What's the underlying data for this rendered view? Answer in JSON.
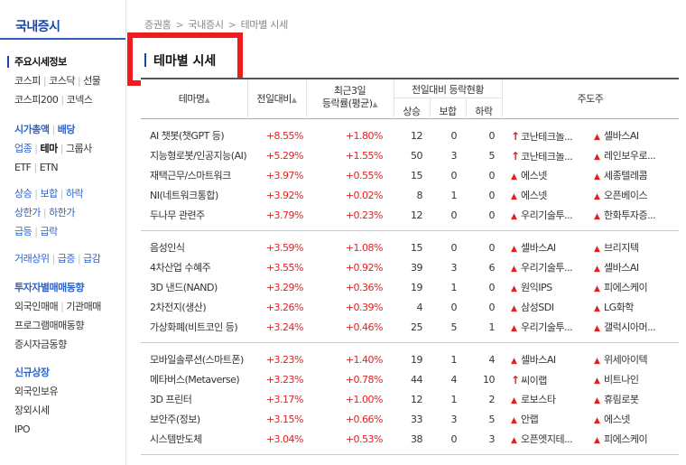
{
  "sidebar": {
    "title": "국내증시",
    "groups": [
      {
        "title": "주요시세정보",
        "rows": [
          [
            "코스피",
            "코스닥",
            "선물"
          ],
          [
            "코스피200",
            "코넥스"
          ]
        ]
      },
      {
        "title": "시가총액",
        "title2": "배당",
        "rows": [
          [
            "업종",
            "테마",
            "그룹사"
          ],
          [
            "ETF",
            "ETN"
          ]
        ]
      },
      {
        "rows": [
          [
            "상승",
            "보합",
            "하락"
          ],
          [
            "상한가",
            "하한가"
          ],
          [
            "급등",
            "급락"
          ]
        ]
      },
      {
        "rows": [
          [
            "거래상위",
            "급증",
            "급감"
          ]
        ]
      },
      {
        "title": "투자자별매매동향",
        "rows": [
          [
            "외국인매매",
            "기관매매"
          ],
          [
            "프로그램매매동향"
          ],
          [
            "증시자금동향"
          ]
        ]
      },
      {
        "title": "신규상장",
        "rows": [
          [
            "외국인보유"
          ],
          [
            "장외시세"
          ],
          [
            "IPO"
          ]
        ]
      }
    ]
  },
  "breadcrumb": [
    "증권홈",
    "국내증시",
    "테마별 시세"
  ],
  "page_title": "테마별 시세",
  "table": {
    "headers": {
      "name": "테마명",
      "change": "전일대비",
      "change3_line1": "최근3일",
      "change3_line2": "등락률(평균)",
      "status": "전일대비 등락현황",
      "up": "상승",
      "flat": "보합",
      "down": "하락",
      "leaders": "주도주"
    },
    "sort_icon": "▲",
    "groups": [
      [
        {
          "name": "AI 챗봇(챗GPT 등)",
          "chg": "+8.55%",
          "chg3": "+1.80%",
          "up": "12",
          "flat": "0",
          "down": "0",
          "l1": "코난테크놀...",
          "l1a": "limit",
          "l2": "셀바스AI",
          "l2a": "up"
        },
        {
          "name": "지능형로봇/인공지능(AI)",
          "chg": "+5.29%",
          "chg3": "+1.55%",
          "up": "50",
          "flat": "3",
          "down": "5",
          "l1": "코난테크놀...",
          "l1a": "limit",
          "l2": "레인보우로...",
          "l2a": "up"
        },
        {
          "name": "재택근무/스마트워크",
          "chg": "+3.97%",
          "chg3": "+0.55%",
          "up": "15",
          "flat": "0",
          "down": "0",
          "l1": "에스넷",
          "l1a": "up",
          "l2": "세종텔레콤",
          "l2a": "up"
        },
        {
          "name": "NI(네트워크통합)",
          "chg": "+3.92%",
          "chg3": "+0.02%",
          "up": "8",
          "flat": "1",
          "down": "0",
          "l1": "에스넷",
          "l1a": "up",
          "l2": "오픈베이스",
          "l2a": "up"
        },
        {
          "name": "두나무 관련주",
          "chg": "+3.79%",
          "chg3": "+0.23%",
          "up": "12",
          "flat": "0",
          "down": "0",
          "l1": "우리기술투...",
          "l1a": "up",
          "l2": "한화투자증...",
          "l2a": "up"
        }
      ],
      [
        {
          "name": "음성인식",
          "chg": "+3.59%",
          "chg3": "+1.08%",
          "up": "15",
          "flat": "0",
          "down": "0",
          "l1": "셀바스AI",
          "l1a": "up",
          "l2": "브리지텍",
          "l2a": "up"
        },
        {
          "name": "4차산업 수혜주",
          "chg": "+3.55%",
          "chg3": "+0.92%",
          "up": "39",
          "flat": "3",
          "down": "6",
          "l1": "우리기술투...",
          "l1a": "up",
          "l2": "셀바스AI",
          "l2a": "up"
        },
        {
          "name": "3D 낸드(NAND)",
          "chg": "+3.29%",
          "chg3": "+0.36%",
          "up": "19",
          "flat": "1",
          "down": "0",
          "l1": "원익IPS",
          "l1a": "up",
          "l2": "피에스케이",
          "l2a": "up"
        },
        {
          "name": "2차전지(생산)",
          "chg": "+3.26%",
          "chg3": "+0.39%",
          "up": "4",
          "flat": "0",
          "down": "0",
          "l1": "삼성SDI",
          "l1a": "up",
          "l2": "LG화학",
          "l2a": "up"
        },
        {
          "name": "가상화폐(비트코인 등)",
          "chg": "+3.24%",
          "chg3": "+0.46%",
          "up": "25",
          "flat": "5",
          "down": "1",
          "l1": "우리기술투...",
          "l1a": "up",
          "l2": "갤럭시아머...",
          "l2a": "up"
        }
      ],
      [
        {
          "name": "모바일솔루션(스마트폰)",
          "chg": "+3.23%",
          "chg3": "+1.40%",
          "up": "19",
          "flat": "1",
          "down": "4",
          "l1": "셀바스AI",
          "l1a": "up",
          "l2": "위세아이텍",
          "l2a": "up"
        },
        {
          "name": "메타버스(Metaverse)",
          "chg": "+3.23%",
          "chg3": "+0.78%",
          "up": "44",
          "flat": "4",
          "down": "10",
          "l1": "씨이랩",
          "l1a": "limit",
          "l2": "비트나인",
          "l2a": "up"
        },
        {
          "name": "3D 프린터",
          "chg": "+3.17%",
          "chg3": "+1.00%",
          "up": "12",
          "flat": "1",
          "down": "2",
          "l1": "로보스타",
          "l1a": "up",
          "l2": "휴림로봇",
          "l2a": "up"
        },
        {
          "name": "보안주(정보)",
          "chg": "+3.15%",
          "chg3": "+0.66%",
          "up": "33",
          "flat": "3",
          "down": "5",
          "l1": "안랩",
          "l1a": "up",
          "l2": "에스넷",
          "l2a": "up"
        },
        {
          "name": "시스템반도체",
          "chg": "+3.04%",
          "chg3": "+0.53%",
          "up": "38",
          "flat": "0",
          "down": "3",
          "l1": "오픈엣지테...",
          "l1a": "up",
          "l2": "피에스케이",
          "l2a": "up"
        }
      ]
    ]
  },
  "colors": {
    "up": "#e02121",
    "brand": "#1a47a6",
    "highlight": "#ee1c1c"
  }
}
